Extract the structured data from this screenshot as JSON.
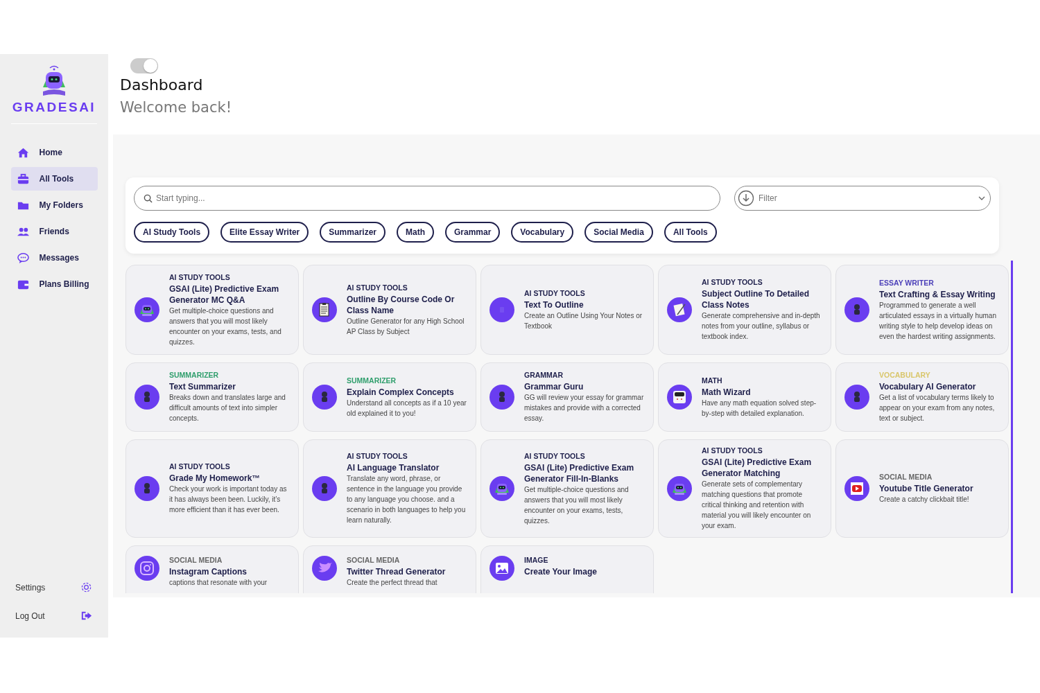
{
  "sidebar": {
    "brand": "GRADESAI",
    "items": [
      {
        "label": "Home",
        "selected": false
      },
      {
        "label": "All Tools",
        "selected": true
      },
      {
        "label": "My Folders",
        "selected": false
      },
      {
        "label": "Friends",
        "selected": false
      },
      {
        "label": "Messages",
        "selected": false
      },
      {
        "label": "Plans Billing",
        "selected": false
      }
    ],
    "footer": [
      {
        "label": "Settings"
      },
      {
        "label": "Log Out"
      }
    ]
  },
  "header": {
    "toggle": {
      "on": true
    },
    "title": "Dashboard",
    "subtitle": "Welcome back!"
  },
  "search": {
    "placeholder": "Start typing...",
    "filter_placeholder": "Filter"
  },
  "chips": [
    "AI Study Tools",
    "Elite Essay Writer",
    "Summarizer",
    "Math",
    "Grammar",
    "Vocabulary",
    "Social Media",
    "All Tools"
  ],
  "cards": [
    {
      "category": "AI STUDY TOOLS",
      "color": "#1e1f4b",
      "title": "GSAI (Lite) Predictive Exam Generator MC Q&A",
      "description": "Get multiple-choice questions and answers that you will most likely encounter on your exams, tests, and quizzes.",
      "kind": "robot"
    },
    {
      "category": "AI STUDY TOOLS",
      "color": "#1e1f4b",
      "title": "Outline By Course Code Or Class Name",
      "description": "Outline Generator for any High School AP Class by Subject",
      "kind": "clipboard"
    },
    {
      "category": "AI STUDY TOOLS",
      "color": "#1e1f4b",
      "title": "Text To Outline",
      "description": "Create an Outline Using Your Notes or Textbook",
      "kind": "blank"
    },
    {
      "category": "AI STUDY TOOLS",
      "color": "#1e1f4b",
      "title": "Subject Outline To Detailed Class Notes",
      "description": "Generate comprehensive and in-depth notes from your outline, syllabus or textbook index.",
      "kind": "notepad"
    },
    {
      "category": "ESSAY WRITER",
      "color": "#4b3fb8",
      "title": "Text Crafting & Essay Writing",
      "description": "Programmed to generate a well articulated essays in a virtually human writing style to help develop ideas on even the hardest writing assignments.",
      "kind": "figure"
    },
    {
      "category": "SUMMARIZER",
      "color": "#2f9e6c",
      "title": "Text Summarizer",
      "description": "Breaks down and translates large and difficult amounts of text into simpler concepts.",
      "kind": "figure"
    },
    {
      "category": "SUMMARIZER",
      "color": "#2f9e6c",
      "title": "Explain Complex Concepts",
      "description": "Understand all concepts as if a 10 year old explained it to you!",
      "kind": "figure"
    },
    {
      "category": "GRAMMAR",
      "color": "#1e1f4b",
      "title": "Grammar Guru",
      "description": "GG will review your essay for grammar mistakes and provide with a corrected essay.",
      "kind": "figure"
    },
    {
      "category": "MATH",
      "color": "#1e1f4b",
      "title": "Math Wizard",
      "description": "Have any math equation solved step-by-step with detailed explanation.",
      "kind": "calculator"
    },
    {
      "category": "VOCABULARY",
      "color": "#d9c66a",
      "title": "Vocabulary AI Generator",
      "description": "Get a list of vocabulary terms likely to appear on your exam from any notes, text or subject.",
      "kind": "figure"
    },
    {
      "category": "AI STUDY TOOLS",
      "color": "#1e1f4b",
      "title": "Grade My Homework™",
      "description": "Check your work is important today as it has always been been.  Luckily, it’s more efficient than it has ever been.",
      "kind": "figure"
    },
    {
      "category": "AI STUDY TOOLS",
      "color": "#1e1f4b",
      "title": "AI Language Translator",
      "description": "Translate any word, phrase, or sentence in the language you provide to any language you choose. and a scenario in both languages to help you learn naturally.",
      "kind": "figure"
    },
    {
      "category": "AI STUDY TOOLS",
      "color": "#1e1f4b",
      "title": "GSAI (Lite) Predictive Exam Generator Fill-In-Blanks",
      "description": "Get multiple-choice questions and answers that you will most likely encounter on your exams, tests, quizzes.",
      "kind": "robot"
    },
    {
      "category": "AI STUDY TOOLS",
      "color": "#1e1f4b",
      "title": "GSAI (Lite) Predictive Exam Generator Matching",
      "description": "Generate sets of complementary matching questions that promote critical thinking and retention with material you will likely encounter on your exam.",
      "kind": "robot"
    },
    {
      "category": "SOCIAL MEDIA",
      "color": "#666666",
      "title": "Youtube Title Generator",
      "description": "Create a catchy clickbait title!",
      "kind": "youtube"
    },
    {
      "category": "SOCIAL MEDIA",
      "color": "#666666",
      "title": "Instagram Captions",
      "description": "captions that resonate with your",
      "kind": "instagram"
    },
    {
      "category": "SOCIAL MEDIA",
      "color": "#666666",
      "title": "Twitter Thread Generator",
      "description": "Create the perfect thread that",
      "kind": "bird"
    },
    {
      "category": "IMAGE",
      "color": "#1e1f4b",
      "title": "Create Your Image",
      "kind": "image"
    }
  ]
}
